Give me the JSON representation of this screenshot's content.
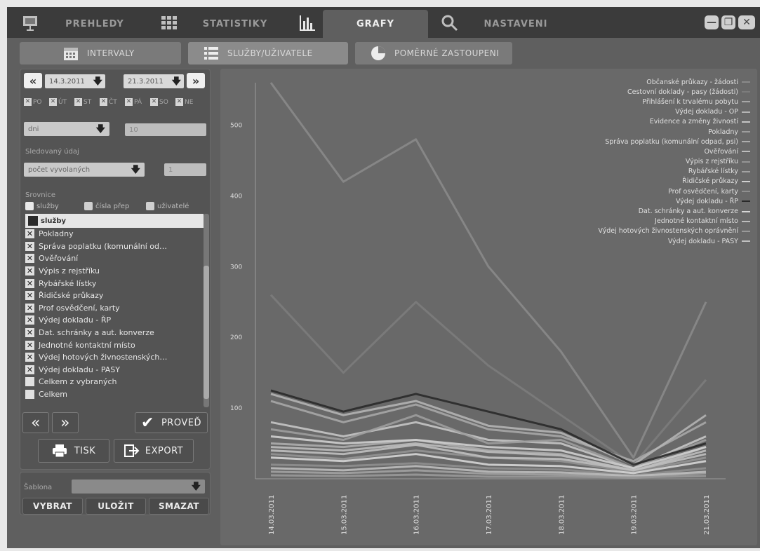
{
  "top_tabs": [
    {
      "label": "PREHLEDY"
    },
    {
      "label": "STATISTIKY"
    },
    {
      "label": "GRAFY"
    },
    {
      "label": "NASTAVENI"
    }
  ],
  "sub_tabs": [
    {
      "label": "INTERVALY"
    },
    {
      "label": "SLUŽBY/UŽIVATELE"
    },
    {
      "label": "POMĚRNÉ ZASTOUPENI"
    }
  ],
  "filters": {
    "date_from": "14.3.2011",
    "date_to": "21.3.2011",
    "days": [
      "PO",
      "ÚT",
      "ST",
      "ČT",
      "PÁ",
      "SO",
      "NE"
    ],
    "group_by": "dni",
    "group_input": "10",
    "section_label": "Sledovaný údaj",
    "metric": "počet vyvolaných",
    "metric_value": "1",
    "compare_label": "Srovnice",
    "radio": [
      "služby",
      "čísla přep",
      "uživatelé"
    ],
    "list_header": "služby",
    "items": [
      {
        "label": "Pokladny",
        "checked": true
      },
      {
        "label": "Správa poplatku (komunální od…",
        "checked": true
      },
      {
        "label": "Ověřování",
        "checked": true
      },
      {
        "label": "Výpis z rejstříku",
        "checked": true
      },
      {
        "label": "Rybářské lístky",
        "checked": true
      },
      {
        "label": "Řidičské průkazy",
        "checked": true
      },
      {
        "label": "Prof osvědčení, karty",
        "checked": true
      },
      {
        "label": "Výdej dokladu - ŘP",
        "checked": true
      },
      {
        "label": "Dat. schránky a aut. konverze",
        "checked": true
      },
      {
        "label": "Jednotné kontaktní místo",
        "checked": true
      },
      {
        "label": "Výdej hotových živnostenských…",
        "checked": true
      },
      {
        "label": "Výdej dokladu - PASY",
        "checked": true
      },
      {
        "label": "Celkem z vybraných",
        "checked": false
      },
      {
        "label": "Celkem",
        "checked": false
      }
    ]
  },
  "actions": {
    "prev": "«",
    "next": "»",
    "run": "PROVEĎ",
    "print": "TISK",
    "export": "EXPORT",
    "template_label": "Šablona",
    "pick": "VYBRAT",
    "save": "ULOŽIT",
    "delete": "SMAZAT"
  },
  "window_buttons": [
    "—",
    "❐",
    "✕"
  ],
  "colors": {
    "panel": "#5f5f5f",
    "chart_bg": "#696969",
    "text": "#e0e0e0"
  },
  "chart_data": {
    "type": "line",
    "categories": [
      "14.03.2011",
      "15.03.2011",
      "16.03.2011",
      "17.03.2011",
      "18.03.2011",
      "19.03.2011",
      "21.03.2011"
    ],
    "ylim": [
      0,
      560
    ],
    "yticks": [
      100,
      200,
      300,
      400,
      500
    ],
    "grid": false,
    "legend_position": "top-right",
    "series": [
      {
        "name": "Občanské průkazy - žádosti",
        "color": "#8a8a8a",
        "values": [
          560,
          420,
          480,
          300,
          180,
          30,
          250
        ]
      },
      {
        "name": "Cestovní doklady - pasy (žádosti)",
        "color": "#7c7c7c",
        "values": [
          260,
          150,
          250,
          160,
          90,
          20,
          140
        ]
      },
      {
        "name": "Přihlášení k trvalému pobytu",
        "color": "#a7a7a7",
        "values": [
          110,
          80,
          105,
          70,
          60,
          25,
          80
        ]
      },
      {
        "name": "Výdej dokladu - OP",
        "color": "#b4b4b4",
        "values": [
          120,
          90,
          110,
          75,
          65,
          20,
          90
        ]
      },
      {
        "name": "Evidence a změny živností",
        "color": "#c5c5c5",
        "values": [
          80,
          60,
          80,
          55,
          50,
          15,
          60
        ]
      },
      {
        "name": "Pokladny",
        "color": "#9d9d9d",
        "values": [
          70,
          55,
          90,
          50,
          55,
          15,
          55
        ]
      },
      {
        "name": "Správa poplatku (komunální odpad, psi)",
        "color": "#adadad",
        "values": [
          50,
          45,
          55,
          40,
          35,
          10,
          45
        ]
      },
      {
        "name": "Ověřování",
        "color": "#bdbdbd",
        "values": [
          45,
          40,
          50,
          38,
          33,
          12,
          40
        ]
      },
      {
        "name": "Výpis z rejstříku",
        "color": "#949494",
        "values": [
          35,
          28,
          40,
          30,
          25,
          10,
          30
        ]
      },
      {
        "name": "Rybářské lístky",
        "color": "#a2a2a2",
        "values": [
          10,
          8,
          12,
          7,
          6,
          3,
          8
        ]
      },
      {
        "name": "Řidičské průkazy",
        "color": "#cfcfcf",
        "values": [
          60,
          50,
          55,
          45,
          40,
          15,
          45
        ]
      },
      {
        "name": "Prof osvědčení, karty",
        "color": "#8f8f8f",
        "values": [
          20,
          18,
          22,
          15,
          13,
          5,
          15
        ]
      },
      {
        "name": "Výdej dokladu - ŘP",
        "color": "#2a2a2a",
        "values": [
          125,
          95,
          120,
          95,
          70,
          20,
          50
        ]
      },
      {
        "name": "Dat. schránky a aut. konverze",
        "color": "#d6d6d6",
        "values": [
          30,
          25,
          35,
          20,
          18,
          8,
          25
        ]
      },
      {
        "name": "Jednotné kontaktní místo",
        "color": "#bcbcbc",
        "values": [
          15,
          12,
          18,
          10,
          9,
          4,
          10
        ]
      },
      {
        "name": "Výdej hotových živnostenských oprávnění",
        "color": "#999999",
        "values": [
          5,
          4,
          6,
          3,
          3,
          2,
          4
        ]
      },
      {
        "name": "Výdej dokladu - PASY",
        "color": "#c0c0c0",
        "values": [
          40,
          35,
          48,
          30,
          28,
          12,
          35
        ]
      }
    ]
  }
}
